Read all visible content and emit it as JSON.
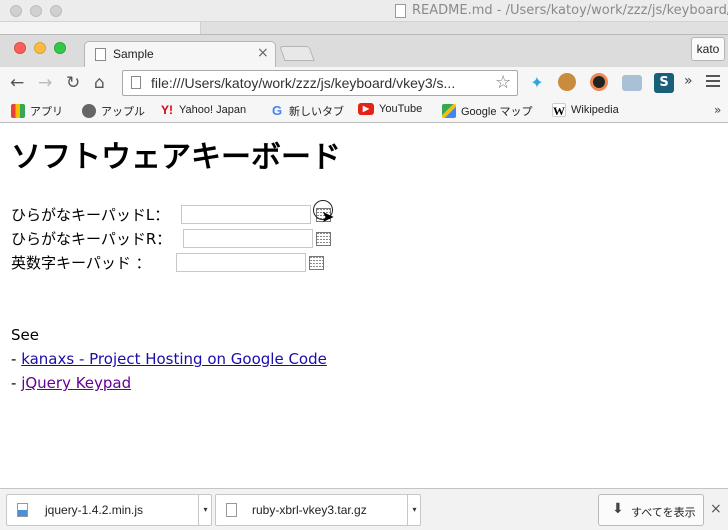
{
  "background_window": {
    "title": "README.md - /Users/katoy/work/zzz/js/keyboard/v"
  },
  "tab": {
    "title": "Sample",
    "close_glyph": "×"
  },
  "profile": {
    "name": "kato"
  },
  "omnibox": {
    "url": "file:///Users/katoy/work/zzz/js/keyboard/vkey3/s..."
  },
  "bookmarks": [
    {
      "label": "アプリ",
      "icon": "apps-icon"
    },
    {
      "label": "アップル",
      "icon": "apple-icon"
    },
    {
      "label": "Yahoo! Japan",
      "icon": "yahoo-icon"
    },
    {
      "label": "新しいタブ",
      "icon": "google-icon"
    },
    {
      "label": "YouTube",
      "icon": "youtube-icon"
    },
    {
      "label": "Google マップ",
      "icon": "google-maps-icon"
    },
    {
      "label": "Wikipedia",
      "icon": "wikipedia-icon"
    }
  ],
  "page": {
    "heading": "ソフトウェアキーボード",
    "fields": [
      {
        "label": "ひらがなキーパッドL：",
        "value": ""
      },
      {
        "label": "ひらがなキーパッドR：",
        "value": ""
      },
      {
        "label": "英数字キーパッド ：",
        "value": ""
      }
    ],
    "see_label": "See",
    "links": [
      {
        "prefix": "- ",
        "text": "kanaxs - Project Hosting on Google Code",
        "visited": false
      },
      {
        "prefix": "- ",
        "text": "jQuery Keypad",
        "visited": true
      }
    ]
  },
  "downloads": {
    "items": [
      {
        "name": "jquery-1.4.2.min.js"
      },
      {
        "name": "ruby-xbrl-vkey3.tar.gz"
      }
    ],
    "show_all_label": "すべてを表示",
    "close_glyph": "×"
  },
  "colors": {
    "link": "#1a0dab",
    "link_visited": "#660099",
    "close_red": "#fc605b",
    "minimize_yellow": "#fdbc40",
    "zoom_green": "#34c84a"
  }
}
